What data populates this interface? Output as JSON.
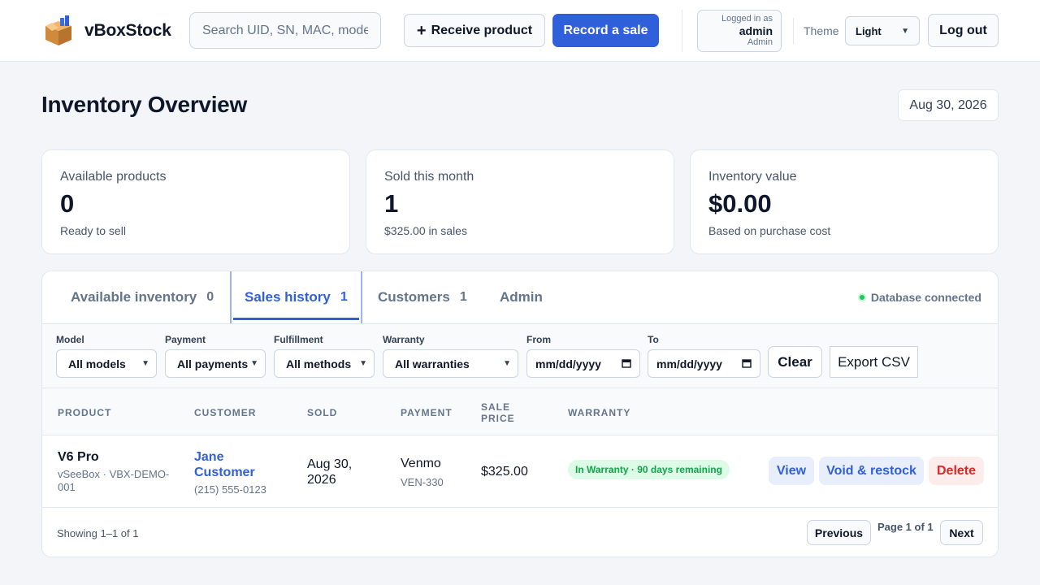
{
  "header": {
    "brand": "vBoxStock",
    "search_placeholder": "Search UID, SN, MAC, model",
    "receive_label": "Receive product",
    "record_label": "Record a sale",
    "user": {
      "line1": "Logged in as",
      "name": "admin",
      "role": "Admin"
    },
    "theme_label": "Theme",
    "theme_value": "Light",
    "logout_label": "Log out"
  },
  "page": {
    "title": "Inventory Overview",
    "date": "Aug 30, 2026"
  },
  "stats": [
    {
      "title": "Available products",
      "value": "0",
      "sub": "Ready to sell"
    },
    {
      "title": "Sold this month",
      "value": "1",
      "sub": "$325.00 in sales"
    },
    {
      "title": "Inventory value",
      "value": "$0.00",
      "sub": "Based on purchase cost"
    }
  ],
  "tabs": [
    {
      "label": "Available inventory",
      "count": "0"
    },
    {
      "label": "Sales history",
      "count": "1"
    },
    {
      "label": "Customers",
      "count": "1"
    },
    {
      "label": "Admin",
      "count": ""
    }
  ],
  "active_tab": "Sales history",
  "db_status": "Database connected",
  "filters": {
    "model": {
      "label": "Model",
      "value": "All models"
    },
    "payment": {
      "label": "Payment",
      "value": "All payments"
    },
    "fulfillment": {
      "label": "Fulfillment",
      "value": "All methods"
    },
    "warranty": {
      "label": "Warranty",
      "value": "All warranties"
    },
    "from": {
      "label": "From",
      "placeholder": "mm/dd/yyyy"
    },
    "to": {
      "label": "To",
      "placeholder": "mm/dd/yyyy"
    },
    "clear_label": "Clear",
    "export_label": "Export CSV"
  },
  "table": {
    "columns": [
      "Product",
      "Customer",
      "Sold",
      "Payment",
      "Sale price",
      "Warranty"
    ],
    "rows": [
      {
        "product": "V6 Pro",
        "product_sub": "vSeeBox · VBX-DEMO-001",
        "customer": "Jane Customer",
        "phone": "(215) 555-0123",
        "sold": "Aug 30, 2026",
        "payment": "Venmo",
        "payment_ref": "VEN-330",
        "price": "$325.00",
        "warranty": "In Warranty · 90 days remaining",
        "actions": {
          "view": "View",
          "void": "Void & restock",
          "delete": "Delete"
        }
      }
    ]
  },
  "pagination": {
    "showing": "Showing 1–1 of 1",
    "previous": "Previous",
    "page_info": "Page 1 of 1",
    "next": "Next"
  },
  "colors": {
    "accent": "#2f5fdb",
    "success": "#16a34a",
    "danger": "#dc2626"
  }
}
